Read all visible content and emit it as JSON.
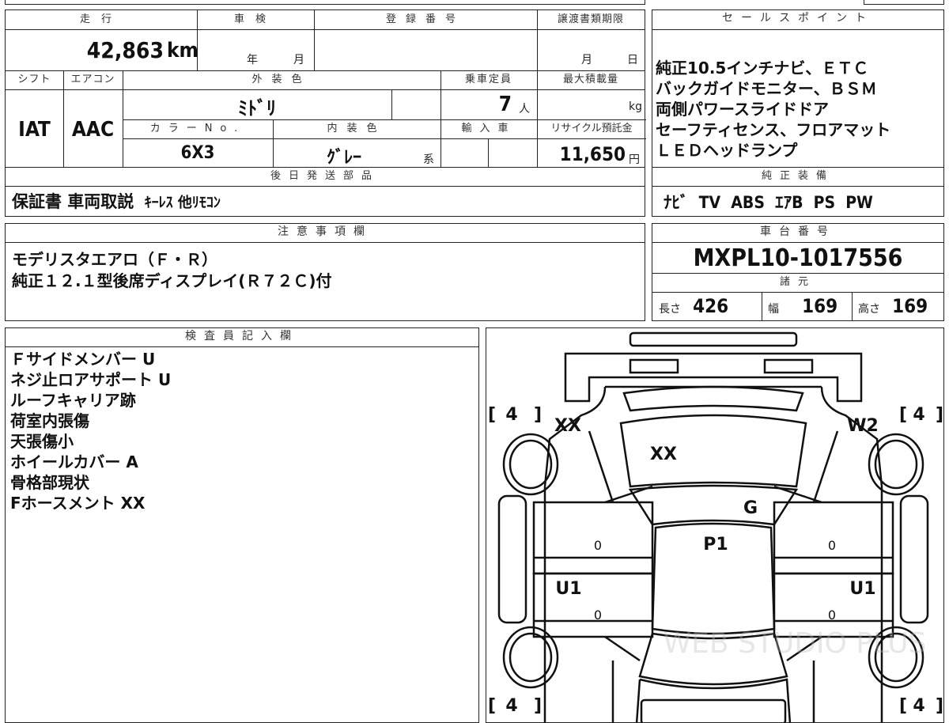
{
  "top": {
    "mileage_label": "走行",
    "mileage_value": "42,863",
    "mileage_unit": "km",
    "inspection_label": "車検",
    "inspection_year": "年",
    "inspection_month": "月",
    "reg_label": "登録番号",
    "transfer_label": "譲渡書類期限",
    "transfer_month": "月",
    "transfer_day": "日"
  },
  "specs": {
    "shift_label": "シフト",
    "shift_value": "IAT",
    "ac_label": "エアコン",
    "ac_value": "AAC",
    "exterior_label": "外装色",
    "exterior_value": "ﾐﾄﾞﾘ",
    "capacity_label": "乗車定員",
    "capacity_value": "7",
    "capacity_unit": "人",
    "load_label": "最大積載量",
    "load_unit": "kg",
    "color_no_label": "カラーNo.",
    "color_no_value": "6X3",
    "interior_label": "内装色",
    "interior_value": "ｸﾞﾚｰ",
    "interior_suffix": "系",
    "import_label": "輸入車",
    "recycle_label": "リサイクル預託金",
    "recycle_value": "11,650",
    "recycle_unit": "円"
  },
  "later_parts": {
    "label": "後日発送部品",
    "value_main": "保証書 車両取説",
    "value_sub": "ｷｰﾚｽ 他ﾘﾓｺﾝ"
  },
  "sales": {
    "label": "セールスポイント",
    "lines": [
      "純正10.5インチナビ、ＥＴＣ",
      "バックガイドモニター、ＢＳＭ",
      "両側パワースライドドア",
      "セーフティセンス、フロアマット",
      "ＬＥＤヘッドランプ"
    ]
  },
  "equipment": {
    "label": "純正装備",
    "value": "ﾅﾋﾞ  TV  ABS  ｴｱB  PS  PW"
  },
  "notes": {
    "label": "注意事項欄",
    "lines": [
      "モデリスタエアロ（Ｆ・Ｒ）",
      "純正１２.１型後席ディスプレイ(Ｒ７２Ｃ)付"
    ]
  },
  "chassis": {
    "label": "車台番号",
    "value": "MXPL10-1017556"
  },
  "dims": {
    "label": "諸元",
    "length_label": "長さ",
    "length_value": "426",
    "width_label": "幅",
    "width_value": "169",
    "height_label": "高さ",
    "height_value": "169"
  },
  "inspector": {
    "label": "検査員記入欄",
    "lines": [
      "Ｆサイドメンバー U",
      "ネジ止ロアサポート U",
      "ルーフキャリア跡",
      "荷室内張傷",
      "天張傷小",
      "ホイールカバー A",
      "骨格部現状",
      "Fホースメント XX"
    ]
  },
  "diagram": {
    "tire_fl": "4",
    "tire_fr": "4",
    "tire_rl": "4",
    "tire_rr": "4",
    "mark_front_left": "XX",
    "mark_bonnet": "XX",
    "mark_front_right": "W2",
    "mark_windshield": "G",
    "mark_roof": "P1",
    "mark_left_sill": "U1",
    "mark_right_sill": "U1",
    "zero_a": "0",
    "zero_b": "0",
    "zero_c": "0",
    "zero_d": "0",
    "watermark": "WEB STUDIO PLUS"
  }
}
